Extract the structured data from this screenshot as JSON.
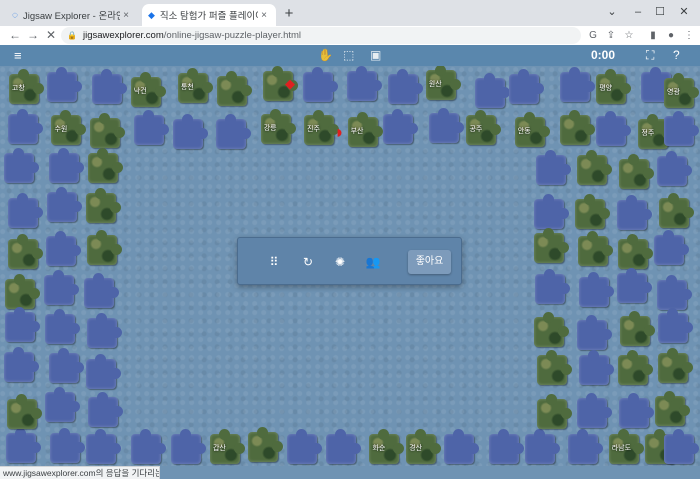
{
  "browser": {
    "tabs": [
      {
        "title": "Jigsaw Explorer - 온라인 직소 퍼",
        "close": "×"
      },
      {
        "title": "직소 탐험가 퍼즐 플레이어",
        "close": "×"
      }
    ],
    "new_tab": "+",
    "window_controls": {
      "chevron": "⌄",
      "minimize": "–",
      "maximize": "☐",
      "close": "✕"
    },
    "url": {
      "host": "jigsawexplorer.com",
      "path": "/online-jigsaw-puzzle-player.html"
    },
    "status_text": "www.jigsawexplorer.com의 응답을 기다리는 중..."
  },
  "app": {
    "menu_icon": "hamburger-menu-icon",
    "timer": "0:00",
    "dialog": {
      "ok_label": "좋아요"
    }
  },
  "board": {
    "place_labels": [
      "고창",
      "낙건",
      "통천",
      "원산",
      "평양",
      "영광",
      "수원",
      "강릉",
      "진주",
      "부산",
      "공주",
      "안동",
      "정주",
      "갑산",
      "화순",
      "경산",
      "라남도"
    ]
  },
  "colors": {
    "appbar": "#5a87ad",
    "board": "#6f93b3",
    "piece_blue": "#4e64a8",
    "piece_map": "#4f6b3e",
    "dialog": "#5f84a9"
  }
}
